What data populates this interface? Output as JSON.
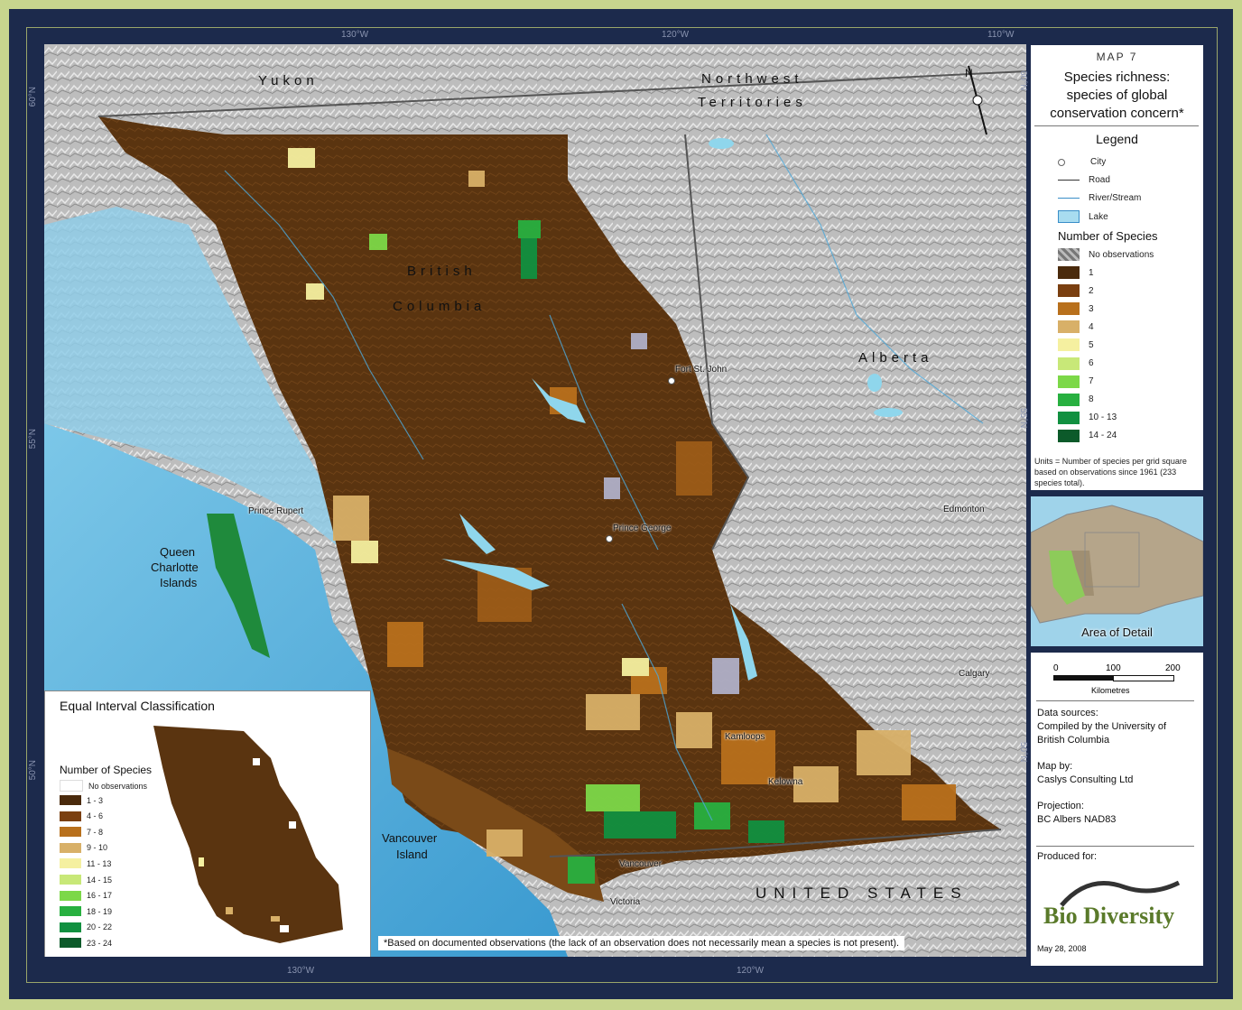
{
  "map_title": {
    "number": "MAP 7",
    "line1": "Species richness:",
    "line2": "species of global",
    "line3": "conservation concern*"
  },
  "legend": {
    "title": "Legend",
    "city": "City",
    "road": "Road",
    "river": "River/Stream",
    "lake": "Lake",
    "species_title": "Number of Species",
    "no_obs": "No observations",
    "classes": [
      {
        "label": "1",
        "color": "#4a2a0c"
      },
      {
        "label": "2",
        "color": "#7a3f10"
      },
      {
        "label": "3",
        "color": "#b8701c"
      },
      {
        "label": "4",
        "color": "#d8b068"
      },
      {
        "label": "5",
        "color": "#f5f0a0"
      },
      {
        "label": "6",
        "color": "#c8e878"
      },
      {
        "label": "7",
        "color": "#7cd848"
      },
      {
        "label": "8",
        "color": "#28b040"
      },
      {
        "label": "10 - 13",
        "color": "#119040"
      },
      {
        "label": "14 - 24",
        "color": "#0c5a2a"
      }
    ],
    "units_note": "Units = Number of species per grid square based on observations since 1961 (233 species total)."
  },
  "overview": {
    "caption": "Area of Detail"
  },
  "scale": {
    "t0": "0",
    "t1": "100",
    "t2": "200",
    "unit": "Kilometres"
  },
  "credits": {
    "sources_h": "Data sources:",
    "sources_1": "Compiled by the University of",
    "sources_2": "British Columbia",
    "mapby_h": "Map by:",
    "mapby": "Caslys Consulting Ltd",
    "proj_h": "Projection:",
    "proj": "BC Albers NAD83",
    "produced": "Produced for:",
    "logo_text": "Bio Diversity",
    "date": "May 28, 2008"
  },
  "ticks": {
    "top": [
      "130°W",
      "120°W",
      "110°W"
    ],
    "bottom": [
      "130°W",
      "120°W"
    ],
    "left": [
      "60°N",
      "55°N",
      "50°N"
    ],
    "right": [
      "60°N",
      "55°N",
      "50°N"
    ]
  },
  "regions": {
    "yukon": "Yukon",
    "nwt1": "Northwest",
    "nwt2": "Territories",
    "bc1": "British",
    "bc2": "Columbia",
    "alberta": "Alberta",
    "usa": "UNITED STATES",
    "qci1": "Queen",
    "qci2": "Charlotte",
    "qci3": "Islands",
    "vi1": "Vancouver",
    "vi2": "Island"
  },
  "cities": {
    "fsj": "Fort St. John",
    "pr": "Prince Rupert",
    "pg": "Prince George",
    "edm": "Edmonton",
    "cal": "Calgary",
    "kam": "Kamloops",
    "kel": "Kelowna",
    "van": "Vancouver",
    "vic": "Victoria"
  },
  "inset": {
    "title": "Equal Interval Classification",
    "species_title": "Number of Species",
    "no_obs": "No observations",
    "classes": [
      {
        "label": "1 - 3",
        "color": "#4a2a0c"
      },
      {
        "label": "4 - 6",
        "color": "#7a3f10"
      },
      {
        "label": "7 - 8",
        "color": "#b8701c"
      },
      {
        "label": "9 - 10",
        "color": "#d8b068"
      },
      {
        "label": "11 - 13",
        "color": "#f5f0a0"
      },
      {
        "label": "14 - 15",
        "color": "#c8e878"
      },
      {
        "label": "16 - 17",
        "color": "#7cd848"
      },
      {
        "label": "18 - 19",
        "color": "#28b040"
      },
      {
        "label": "20 - 22",
        "color": "#119040"
      },
      {
        "label": "23 - 24",
        "color": "#0c5a2a"
      }
    ]
  },
  "footnote": "*Based on documented observations (the lack of an observation does not necessarily mean a species is not present)."
}
